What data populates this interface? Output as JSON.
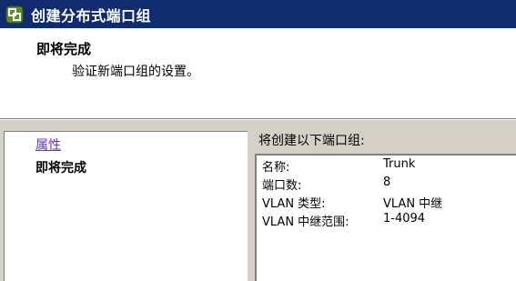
{
  "window": {
    "title": "创建分布式端口组",
    "icon": "vsphere-logo-icon",
    "titlebar_color": "#102c6e"
  },
  "header": {
    "step_title": "即将完成",
    "step_description": "验证新端口组的设置。"
  },
  "nav": {
    "items": [
      {
        "label": "属性",
        "state": "visited"
      },
      {
        "label": "即将完成",
        "state": "current"
      }
    ],
    "link_color": "#6633cc"
  },
  "summary": {
    "heading": "将创建以下端口组:",
    "rows": [
      {
        "key": "名称:",
        "value": "Trunk"
      },
      {
        "key": "端口数:",
        "value": "8"
      },
      {
        "key": "VLAN 类型:",
        "value": "VLAN 中继"
      },
      {
        "key": "VLAN 中继范围:",
        "value": "1-4094"
      }
    ]
  }
}
